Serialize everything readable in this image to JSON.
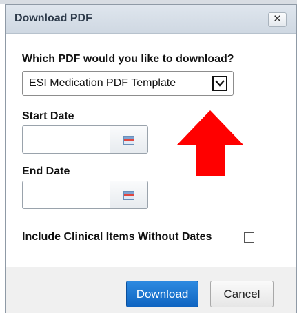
{
  "dialog": {
    "title": "Download PDF",
    "close_label": "✕"
  },
  "pdf_select": {
    "question": "Which PDF would you like to download?",
    "selected": "ESI Medication PDF Template"
  },
  "start_date": {
    "label": "Start Date",
    "value": ""
  },
  "end_date": {
    "label": "End Date",
    "value": ""
  },
  "include_undated": {
    "label": "Include Clinical Items Without Dates",
    "checked": false
  },
  "footer": {
    "download_label": "Download",
    "cancel_label": "Cancel"
  },
  "colors": {
    "primary_button": "#1676d2",
    "annotation_arrow": "#ff0000"
  },
  "icons": {
    "close": "close-icon",
    "dropdown": "chevron-down-icon",
    "calendar": "calendar-icon",
    "annotation": "up-arrow-annotation"
  }
}
